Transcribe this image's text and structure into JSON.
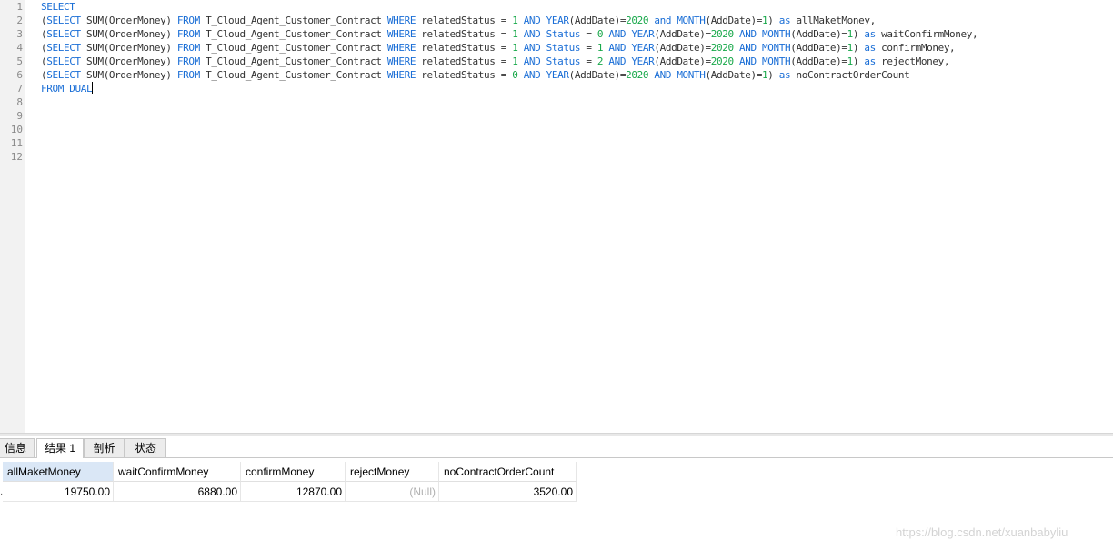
{
  "editor": {
    "line_numbers": [
      "1",
      "2",
      "3",
      "4",
      "5",
      "6",
      "7",
      "8",
      "9",
      "10",
      "11",
      "12"
    ],
    "lines": [
      [
        {
          "t": "SELECT",
          "c": "kw"
        }
      ],
      [
        {
          "t": "(",
          "c": "id"
        },
        {
          "t": "SELECT",
          "c": "kw"
        },
        {
          "t": " SUM(OrderMoney) ",
          "c": "id"
        },
        {
          "t": "FROM",
          "c": "kw"
        },
        {
          "t": " T_Cloud_Agent_Customer_Contract ",
          "c": "id"
        },
        {
          "t": "WHERE",
          "c": "kw"
        },
        {
          "t": " relatedStatus = ",
          "c": "id"
        },
        {
          "t": "1",
          "c": "num"
        },
        {
          "t": " ",
          "c": "id"
        },
        {
          "t": "AND",
          "c": "kw"
        },
        {
          "t": " ",
          "c": "id"
        },
        {
          "t": "YEAR",
          "c": "kw"
        },
        {
          "t": "(AddDate)=",
          "c": "id"
        },
        {
          "t": "2020",
          "c": "num"
        },
        {
          "t": " ",
          "c": "id"
        },
        {
          "t": "and",
          "c": "kw"
        },
        {
          "t": " ",
          "c": "id"
        },
        {
          "t": "MONTH",
          "c": "kw"
        },
        {
          "t": "(AddDate)=",
          "c": "id"
        },
        {
          "t": "1",
          "c": "num"
        },
        {
          "t": ") ",
          "c": "id"
        },
        {
          "t": "as",
          "c": "kw"
        },
        {
          "t": " allMaketMoney,",
          "c": "id"
        }
      ],
      [
        {
          "t": "(",
          "c": "id"
        },
        {
          "t": "SELECT",
          "c": "kw"
        },
        {
          "t": " SUM(OrderMoney) ",
          "c": "id"
        },
        {
          "t": "FROM",
          "c": "kw"
        },
        {
          "t": " T_Cloud_Agent_Customer_Contract ",
          "c": "id"
        },
        {
          "t": "WHERE",
          "c": "kw"
        },
        {
          "t": " relatedStatus = ",
          "c": "id"
        },
        {
          "t": "1",
          "c": "num"
        },
        {
          "t": " ",
          "c": "id"
        },
        {
          "t": "AND",
          "c": "kw"
        },
        {
          "t": " ",
          "c": "id"
        },
        {
          "t": "Status",
          "c": "kw"
        },
        {
          "t": " = ",
          "c": "id"
        },
        {
          "t": "0",
          "c": "num"
        },
        {
          "t": " ",
          "c": "id"
        },
        {
          "t": "AND",
          "c": "kw"
        },
        {
          "t": " ",
          "c": "id"
        },
        {
          "t": "YEAR",
          "c": "kw"
        },
        {
          "t": "(AddDate)=",
          "c": "id"
        },
        {
          "t": "2020",
          "c": "num"
        },
        {
          "t": " ",
          "c": "id"
        },
        {
          "t": "AND",
          "c": "kw"
        },
        {
          "t": " ",
          "c": "id"
        },
        {
          "t": "MONTH",
          "c": "kw"
        },
        {
          "t": "(AddDate)=",
          "c": "id"
        },
        {
          "t": "1",
          "c": "num"
        },
        {
          "t": ") ",
          "c": "id"
        },
        {
          "t": "as",
          "c": "kw"
        },
        {
          "t": " waitConfirmMoney,",
          "c": "id"
        }
      ],
      [
        {
          "t": "(",
          "c": "id"
        },
        {
          "t": "SELECT",
          "c": "kw"
        },
        {
          "t": " SUM(OrderMoney) ",
          "c": "id"
        },
        {
          "t": "FROM",
          "c": "kw"
        },
        {
          "t": " T_Cloud_Agent_Customer_Contract ",
          "c": "id"
        },
        {
          "t": "WHERE",
          "c": "kw"
        },
        {
          "t": " relatedStatus = ",
          "c": "id"
        },
        {
          "t": "1",
          "c": "num"
        },
        {
          "t": " ",
          "c": "id"
        },
        {
          "t": "AND",
          "c": "kw"
        },
        {
          "t": " ",
          "c": "id"
        },
        {
          "t": "Status",
          "c": "kw"
        },
        {
          "t": " = ",
          "c": "id"
        },
        {
          "t": "1",
          "c": "num"
        },
        {
          "t": " ",
          "c": "id"
        },
        {
          "t": "AND",
          "c": "kw"
        },
        {
          "t": " ",
          "c": "id"
        },
        {
          "t": "YEAR",
          "c": "kw"
        },
        {
          "t": "(AddDate)=",
          "c": "id"
        },
        {
          "t": "2020",
          "c": "num"
        },
        {
          "t": " ",
          "c": "id"
        },
        {
          "t": "AND",
          "c": "kw"
        },
        {
          "t": " ",
          "c": "id"
        },
        {
          "t": "MONTH",
          "c": "kw"
        },
        {
          "t": "(AddDate)=",
          "c": "id"
        },
        {
          "t": "1",
          "c": "num"
        },
        {
          "t": ") ",
          "c": "id"
        },
        {
          "t": "as",
          "c": "kw"
        },
        {
          "t": " confirmMoney,",
          "c": "id"
        }
      ],
      [
        {
          "t": "(",
          "c": "id"
        },
        {
          "t": "SELECT",
          "c": "kw"
        },
        {
          "t": " SUM(OrderMoney) ",
          "c": "id"
        },
        {
          "t": "FROM",
          "c": "kw"
        },
        {
          "t": " T_Cloud_Agent_Customer_Contract ",
          "c": "id"
        },
        {
          "t": "WHERE",
          "c": "kw"
        },
        {
          "t": " relatedStatus = ",
          "c": "id"
        },
        {
          "t": "1",
          "c": "num"
        },
        {
          "t": " ",
          "c": "id"
        },
        {
          "t": "AND",
          "c": "kw"
        },
        {
          "t": " ",
          "c": "id"
        },
        {
          "t": "Status",
          "c": "kw"
        },
        {
          "t": " = ",
          "c": "id"
        },
        {
          "t": "2",
          "c": "num"
        },
        {
          "t": " ",
          "c": "id"
        },
        {
          "t": "AND",
          "c": "kw"
        },
        {
          "t": " ",
          "c": "id"
        },
        {
          "t": "YEAR",
          "c": "kw"
        },
        {
          "t": "(AddDate)=",
          "c": "id"
        },
        {
          "t": "2020",
          "c": "num"
        },
        {
          "t": " ",
          "c": "id"
        },
        {
          "t": "AND",
          "c": "kw"
        },
        {
          "t": " ",
          "c": "id"
        },
        {
          "t": "MONTH",
          "c": "kw"
        },
        {
          "t": "(AddDate)=",
          "c": "id"
        },
        {
          "t": "1",
          "c": "num"
        },
        {
          "t": ") ",
          "c": "id"
        },
        {
          "t": "as",
          "c": "kw"
        },
        {
          "t": " rejectMoney,",
          "c": "id"
        }
      ],
      [
        {
          "t": "(",
          "c": "id"
        },
        {
          "t": "SELECT",
          "c": "kw"
        },
        {
          "t": " SUM(OrderMoney) ",
          "c": "id"
        },
        {
          "t": "FROM",
          "c": "kw"
        },
        {
          "t": " T_Cloud_Agent_Customer_Contract ",
          "c": "id"
        },
        {
          "t": "WHERE",
          "c": "kw"
        },
        {
          "t": " relatedStatus = ",
          "c": "id"
        },
        {
          "t": "0",
          "c": "num"
        },
        {
          "t": " ",
          "c": "id"
        },
        {
          "t": "AND",
          "c": "kw"
        },
        {
          "t": " ",
          "c": "id"
        },
        {
          "t": "YEAR",
          "c": "kw"
        },
        {
          "t": "(AddDate)=",
          "c": "id"
        },
        {
          "t": "2020",
          "c": "num"
        },
        {
          "t": " ",
          "c": "id"
        },
        {
          "t": "AND",
          "c": "kw"
        },
        {
          "t": " ",
          "c": "id"
        },
        {
          "t": "MONTH",
          "c": "kw"
        },
        {
          "t": "(AddDate)=",
          "c": "id"
        },
        {
          "t": "1",
          "c": "num"
        },
        {
          "t": ") ",
          "c": "id"
        },
        {
          "t": "as",
          "c": "kw"
        },
        {
          "t": " noContractOrderCount",
          "c": "id"
        }
      ],
      [
        {
          "t": "FROM DUAL",
          "c": "kw"
        }
      ],
      [],
      [],
      [],
      [],
      []
    ]
  },
  "tabs": [
    {
      "label": "信息",
      "active": false
    },
    {
      "label": "结果 1",
      "active": true
    },
    {
      "label": "剖析",
      "active": false
    },
    {
      "label": "状态",
      "active": false
    }
  ],
  "result": {
    "columns": [
      "allMaketMoney",
      "waitConfirmMoney",
      "confirmMoney",
      "rejectMoney",
      "noContractOrderCount"
    ],
    "rows": [
      [
        "19750.00",
        "6880.00",
        "12870.00",
        "(Null)",
        "3520.00"
      ]
    ]
  },
  "watermark": "https://blog.csdn.net/xuanbabyliu",
  "colors": {
    "keyword": "#1a6ed6",
    "number": "#18a84a",
    "text": "#333333",
    "selected_header": "#dae7f6"
  }
}
